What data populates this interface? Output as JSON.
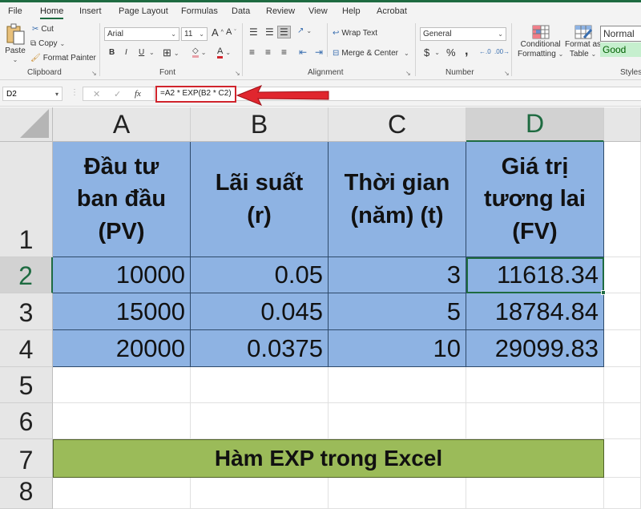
{
  "tabs": [
    "File",
    "Home",
    "Insert",
    "Page Layout",
    "Formulas",
    "Data",
    "Review",
    "View",
    "Help",
    "Acrobat"
  ],
  "active_tab": "Home",
  "ribbon": {
    "clipboard": {
      "paste": "Paste",
      "cut": "Cut",
      "copy": "Copy",
      "format_painter": "Format Painter",
      "label": "Clipboard"
    },
    "font": {
      "name": "Arial",
      "size": "11",
      "bold": "B",
      "italic": "I",
      "underline": "U",
      "grow": "A",
      "shrink": "A",
      "font_color": "A",
      "label": "Font"
    },
    "alignment": {
      "wrap_text": "Wrap Text",
      "merge_center": "Merge & Center",
      "label": "Alignment"
    },
    "number": {
      "format": "General",
      "currency": "$",
      "percent": "%",
      "comma": ",",
      "label": "Number"
    },
    "styles": {
      "conditional_formatting_1": "Conditional",
      "conditional_formatting_2": "Formatting",
      "format_as_table_1": "Format as",
      "format_as_table_2": "Table",
      "normal": "Normal",
      "good": "Good",
      "label": "Styles"
    }
  },
  "formula_bar": {
    "name_box": "D2",
    "cancel": "✕",
    "enter": "✓",
    "fx": "fx",
    "formula": "=A2 * EXP(B2 * C2)"
  },
  "sheet": {
    "columns": [
      "A",
      "B",
      "C",
      "D"
    ],
    "selected_column": "D",
    "rows": [
      "1",
      "2",
      "3",
      "4",
      "5",
      "6",
      "7",
      "8"
    ],
    "selected_row": "2",
    "active_cell": "D2",
    "headers": {
      "A": "Đầu tư ban đầu (PV)",
      "B": "Lãi suất (r)",
      "C": "Thời gian (năm) (t)",
      "D": "Giá trị tương lai (FV)"
    },
    "header_lines": {
      "A": [
        "Đầu tư",
        "ban đầu",
        "(PV)"
      ],
      "B": [
        "Lãi suất",
        "(r)"
      ],
      "C": [
        "Thời gian",
        "(năm) (t)"
      ],
      "D": [
        "Giá trị",
        "tương lai",
        "(FV)"
      ]
    },
    "data": [
      {
        "A": "10000",
        "B": "0.05",
        "C": "3",
        "D": "11618.34"
      },
      {
        "A": "15000",
        "B": "0.045",
        "C": "5",
        "D": "18784.84"
      },
      {
        "A": "20000",
        "B": "0.0375",
        "C": "10",
        "D": "29099.83"
      }
    ],
    "banner": "Hàm EXP trong Excel",
    "colors": {
      "table_fill": "#8eb3e3",
      "banner_fill": "#9bbb59",
      "selection": "#1e6b41",
      "callout": "#d0242c"
    }
  }
}
